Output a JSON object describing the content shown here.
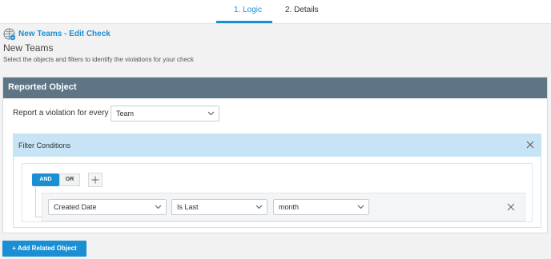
{
  "tabs": [
    {
      "label": "1. Logic",
      "active": true
    },
    {
      "label": "2. Details",
      "active": false
    }
  ],
  "header": {
    "breadcrumb_link": "New Teams - Edit Check",
    "title": "New Teams",
    "description": "Select the objects and filters to identify the violations for your check",
    "icon": "check-globe-icon"
  },
  "reported_object": {
    "title": "Reported Object",
    "report_label": "Report a violation for every",
    "report_value": "Team"
  },
  "filter": {
    "title": "Filter Conditions",
    "operator_and": "AND",
    "operator_or": "OR",
    "selected_operator": "AND",
    "condition": {
      "field": "Created Date",
      "operator": "Is Last",
      "unit": "month"
    }
  },
  "actions": {
    "add_related": "+ Add Related Object"
  },
  "colors": {
    "accent": "#1b8fd3",
    "card_header": "#5d7584",
    "filter_header": "#c6e4f5",
    "background": "#f2f2f3"
  }
}
